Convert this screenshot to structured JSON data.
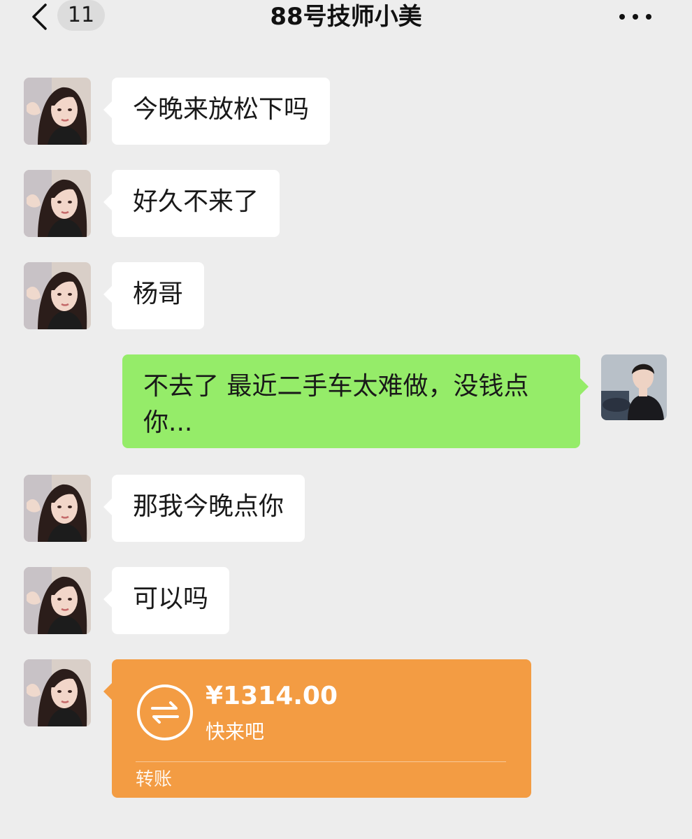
{
  "header": {
    "unread_count": "11",
    "title": "88号技师小美"
  },
  "messages": [
    {
      "sender": "contact",
      "text": "今晚来放松下吗"
    },
    {
      "sender": "contact",
      "text": "好久不来了"
    },
    {
      "sender": "contact",
      "text": "杨哥"
    },
    {
      "sender": "self",
      "text": "不去了 最近二手车太难做，没钱点你..."
    },
    {
      "sender": "contact",
      "text": "那我今晚点你"
    },
    {
      "sender": "contact",
      "text": "可以吗"
    }
  ],
  "transfer": {
    "amount": "¥1314.00",
    "note": "快来吧",
    "label": "转账"
  },
  "colors": {
    "background": "#ededed",
    "incoming_bubble": "#ffffff",
    "outgoing_bubble": "#95ec69",
    "transfer_card": "#f39c43"
  }
}
